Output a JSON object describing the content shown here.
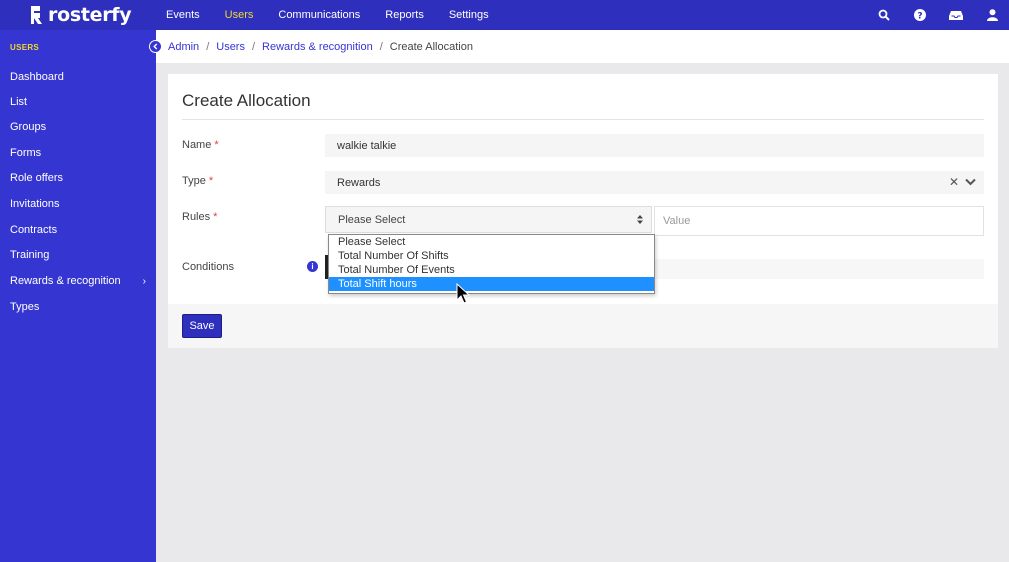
{
  "app": {
    "brand": "rosterfy"
  },
  "topnav": {
    "items": [
      {
        "label": "Events",
        "active": false
      },
      {
        "label": "Users",
        "active": true
      },
      {
        "label": "Communications",
        "active": false
      },
      {
        "label": "Reports",
        "active": false
      },
      {
        "label": "Settings",
        "active": false
      }
    ],
    "icons": [
      "search-icon",
      "help-icon",
      "inbox-icon",
      "user-icon"
    ]
  },
  "sidebar": {
    "heading": "USERS",
    "items": [
      {
        "label": "Dashboard"
      },
      {
        "label": "List"
      },
      {
        "label": "Groups"
      },
      {
        "label": "Forms"
      },
      {
        "label": "Role offers"
      },
      {
        "label": "Invitations"
      },
      {
        "label": "Contracts"
      },
      {
        "label": "Training"
      },
      {
        "label": "Rewards & recognition",
        "has_submenu": true
      },
      {
        "label": "Types"
      }
    ]
  },
  "breadcrumb": {
    "items": [
      "Admin",
      "Users",
      "Rewards & recognition"
    ],
    "current": "Create Allocation"
  },
  "form": {
    "title": "Create Allocation",
    "name": {
      "label": "Name",
      "value": "walkie talkie"
    },
    "type": {
      "label": "Type",
      "value": "Rewards"
    },
    "rules": {
      "label": "Rules",
      "select_value": "Please Select",
      "value_placeholder": "Value",
      "options": [
        {
          "label": "Please Select",
          "selected": false
        },
        {
          "label": "Total Number Of Shifts",
          "selected": false
        },
        {
          "label": "Total Number Of Events",
          "selected": false
        },
        {
          "label": "Total Shift hours",
          "selected": true
        }
      ]
    },
    "conditions": {
      "label": "Conditions"
    },
    "save_label": "Save"
  },
  "colors": {
    "primary": "#2f2fbe",
    "sidebar": "#3535d2",
    "accent": "#f0d92e",
    "required": "#e0404a",
    "highlight": "#1e90ff"
  }
}
